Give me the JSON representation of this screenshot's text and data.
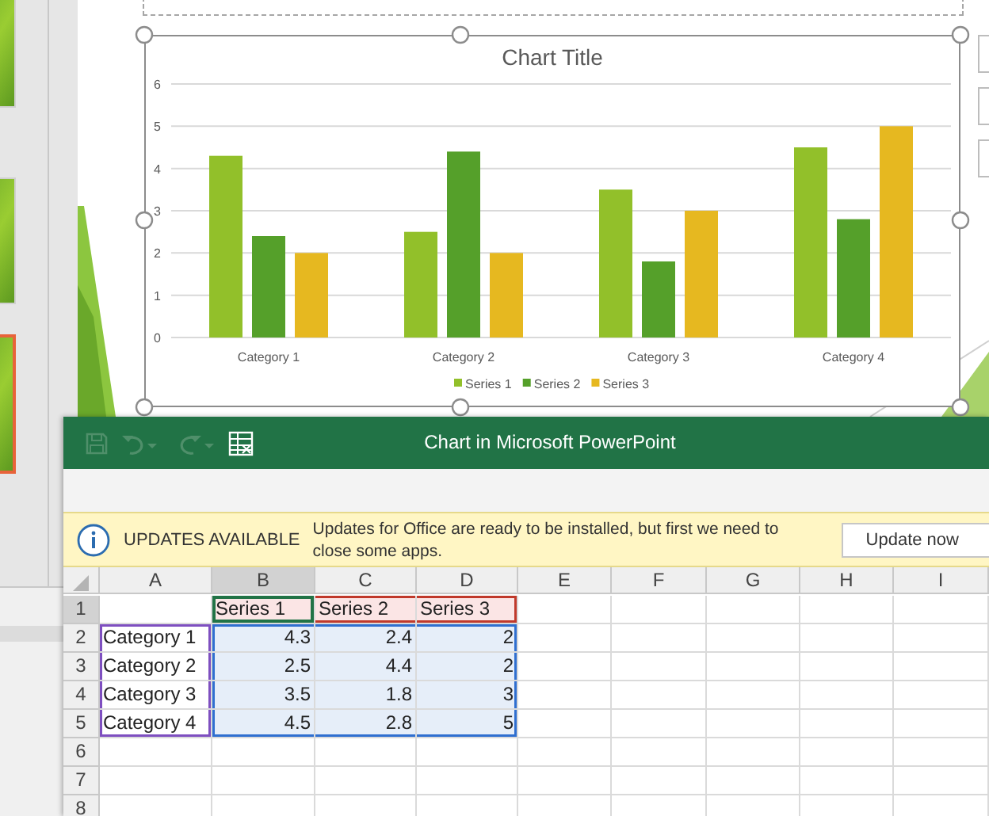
{
  "powerpoint": {
    "slides": [
      {
        "selected": false
      },
      {
        "selected": false
      },
      {
        "selected": true
      }
    ],
    "chart": {
      "chart_data": {
        "type": "bar",
        "title": "Chart Title",
        "categories": [
          "Category 1",
          "Category 2",
          "Category 3",
          "Category 4"
        ],
        "series": [
          {
            "name": "Series 1",
            "color": "#92c02a",
            "values": [
              4.3,
              2.5,
              3.5,
              4.5
            ]
          },
          {
            "name": "Series 2",
            "color": "#55a02a",
            "values": [
              2.4,
              4.4,
              1.8,
              2.8
            ]
          },
          {
            "name": "Series 3",
            "color": "#e6b820",
            "values": [
              2,
              2,
              3,
              5
            ]
          }
        ],
        "ylim": [
          0,
          6
        ],
        "yticks": [
          0,
          1,
          2,
          3,
          4,
          5,
          6
        ],
        "grid": true,
        "legend": true
      }
    }
  },
  "excel": {
    "title": "Chart in Microsoft PowerPoint",
    "quick_access": [
      {
        "kind": "save",
        "disabled": true
      },
      {
        "kind": "undo",
        "disabled": true
      },
      {
        "kind": "redo",
        "disabled": true
      },
      {
        "kind": "edit-data",
        "disabled": false
      }
    ],
    "message_bar": {
      "title": "UPDATES AVAILABLE",
      "text": "Updates for Office are ready to be installed, but first we need to close some apps.",
      "button": "Update now"
    },
    "columns": [
      {
        "label": "A",
        "selected": false
      },
      {
        "label": "B",
        "selected": true
      },
      {
        "label": "C",
        "selected": false
      },
      {
        "label": "D",
        "selected": false
      },
      {
        "label": "E",
        "selected": false
      },
      {
        "label": "F",
        "selected": false
      },
      {
        "label": "G",
        "selected": false
      },
      {
        "label": "H",
        "selected": false
      },
      {
        "label": "I",
        "selected": false
      }
    ],
    "rows": [
      {
        "number": "1",
        "selected": true,
        "cells": [
          {
            "kind": "blank"
          },
          {
            "kind": "series",
            "text": "Series 1",
            "active": true
          },
          {
            "kind": "series",
            "text": "Series 2"
          },
          {
            "kind": "series",
            "text": "Series 3"
          }
        ]
      },
      {
        "number": "2",
        "selected": false,
        "cells": [
          {
            "kind": "category",
            "text": "Category 1"
          },
          {
            "kind": "value",
            "text": "4.3"
          },
          {
            "kind": "value",
            "text": "2.4"
          },
          {
            "kind": "value",
            "text": "2"
          }
        ]
      },
      {
        "number": "3",
        "selected": false,
        "cells": [
          {
            "kind": "category",
            "text": "Category 2"
          },
          {
            "kind": "value",
            "text": "2.5"
          },
          {
            "kind": "value",
            "text": "4.4"
          },
          {
            "kind": "value",
            "text": "2"
          }
        ]
      },
      {
        "number": "4",
        "selected": false,
        "cells": [
          {
            "kind": "category",
            "text": "Category 3"
          },
          {
            "kind": "value",
            "text": "3.5"
          },
          {
            "kind": "value",
            "text": "1.8"
          },
          {
            "kind": "value",
            "text": "3"
          }
        ]
      },
      {
        "number": "5",
        "selected": false,
        "cells": [
          {
            "kind": "category",
            "text": "Category 4"
          },
          {
            "kind": "value",
            "text": "4.5"
          },
          {
            "kind": "value",
            "text": "2.8"
          },
          {
            "kind": "value",
            "text": "5"
          }
        ]
      },
      {
        "number": "6",
        "selected": false
      },
      {
        "number": "7",
        "selected": false
      },
      {
        "number": "8",
        "selected": false
      }
    ]
  }
}
